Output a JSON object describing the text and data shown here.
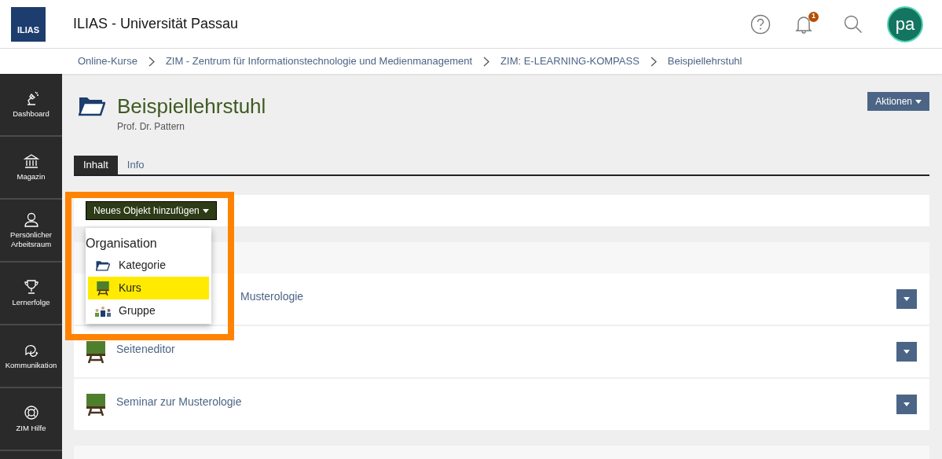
{
  "header": {
    "logo": "ILIAS",
    "title": "ILIAS - Universität Passau",
    "notification_count": "1",
    "avatar": "pa"
  },
  "breadcrumbs": [
    "Online-Kurse",
    "ZIM - Zentrum für Informationstechnologie und Medienmanagement",
    "ZIM: E-LEARNING-KOMPASS",
    "Beispiellehrstuhl"
  ],
  "sidebar": {
    "items": [
      {
        "label": "Dashboard",
        "kind": "dashboard"
      },
      {
        "label": "Magazin",
        "kind": "repository"
      },
      {
        "label": "Persönlicher Arbeitsraum",
        "kind": "person"
      },
      {
        "label": "Lernerfolge",
        "kind": "trophy"
      },
      {
        "label": "Kommunikation",
        "kind": "chat"
      },
      {
        "label": "ZIM Hilfe",
        "kind": "lifebuoy"
      }
    ]
  },
  "page": {
    "title": "Beispiellehrstuhl",
    "subtitle": "Prof. Dr. Pattern",
    "actions_button": "Aktionen"
  },
  "tabs": [
    {
      "label": "Inhalt",
      "selected": true
    },
    {
      "label": "Info",
      "selected": false
    }
  ],
  "add_button": "Neues Objekt hinzufügen",
  "add_menu": {
    "heading": "Organisation",
    "items": [
      {
        "label": "Kategorie",
        "kind": "folder",
        "selected": false
      },
      {
        "label": "Kurs",
        "kind": "course",
        "selected": true
      },
      {
        "label": "Gruppe",
        "kind": "group",
        "selected": false
      }
    ]
  },
  "items": [
    {
      "title": "Musterologie",
      "covered": true
    },
    {
      "title": "Seiteneditor",
      "covered": false
    },
    {
      "title": "Seminar zur Musterologie",
      "covered": false
    }
  ]
}
